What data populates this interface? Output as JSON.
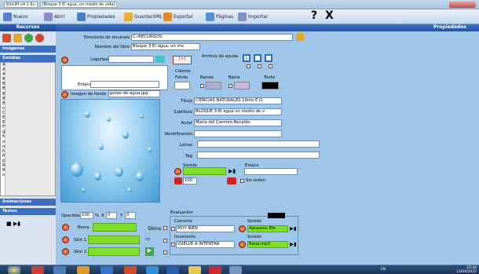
{
  "window": {
    "app_title": "EdiLIM v4.1.6v",
    "document_title": "[Bloque 3 El agua, un medio de vida]"
  },
  "menu": {
    "nuevo": "Nuevo",
    "abrir": "Abrir",
    "propiedades": "Propiedades",
    "guardar": "GuardarXML",
    "exportar": "Exportar",
    "paginas": "Páginas",
    "importar": "Importar",
    "help": "?",
    "close": "X"
  },
  "left": {
    "recursos": "Recursos",
    "imagenes": "Imágenes",
    "sonidos": "Sonidos",
    "sound_files": [
      "ALVARO LA TOC.",
      "Aplausos Efecto",
      "Aplausos Efecto",
      "Bach.mp3",
      "BALADA PARA AD",
      "BALADA PARA AD",
      "BALADA PARA AD",
      "Beethoven.mp3",
      "BG Foleys sonido",
      "caballo.mp3",
      "Cruz Roja Ubeda",
      "EL SONIDO DE LC",
      "Elefante.mp3",
      "Fresa.mp3",
      "gallo.mp3",
      "Manzana.mp3",
      "mozart.mp3",
      "muy bien sigue as",
      "Naranja.mp3",
      "Para Elisa tutoria",
      "prokofiev.mp3",
      "Rana.mp3",
      "Richard Claydem",
      "saint-saens.mp3"
    ],
    "animaciones": "Animaciones",
    "textos": "Textos",
    "play": "■ ▶▮"
  },
  "main": {
    "header": "Propiedades",
    "dir_label": "Directorio de recursos",
    "dir_value": "C:\\RECURSOS\\",
    "book_label": "Nombre del libro",
    "book_value": "Bloque 3 El agua, un me",
    "logotipo": "Logotipo",
    "logo_btn": "[+]",
    "help_file": "Archivo de ayuda",
    "help_i": "i",
    "enlace": "Enlace",
    "imagen_fondo": "Imagen de fondo",
    "fondo_value": "gotas-de-agua.jpg",
    "colores": "Colores",
    "fondo": "Fondo",
    "banda": "Banda",
    "barra": "Barra",
    "texto": "Texto",
    "titulo_label": "Título",
    "titulo_value": "CIENCIAS NATURALES 10mo E.G.",
    "subtitulo_label": "Subtitulo",
    "subtitulo_value": "BLOQUE 3 El agua un medio de v",
    "autor_label": "Autor",
    "autor_value": "María del Carmen Recalde",
    "identificacion_label": "Identificación",
    "letras_label": "Letras",
    "tag_label": "Tag",
    "sonido_label": "Sonido",
    "enlace2_label": "Enlace",
    "volume": "100",
    "sin_orden": "Sin orden",
    "opacidad_label": "Opacidad",
    "opacidad_value": "100",
    "pct": "%",
    "x_label": "X",
    "x_value": "0",
    "y_label": "Y",
    "y_value": "0",
    "barra_label": "Barra",
    "skins": "Skins",
    "skin1": "Skin 1",
    "skin2": "Skin 2",
    "evaluacion": "Evaluación",
    "correcto": "Correcto",
    "correcto_value": "MUY BIEN",
    "sonido_c": "Sonido",
    "sonido_c_value": "Aplausos Efe",
    "incorrecto": "Incorrecto",
    "incorrecto_value": "VUELVE A INTENTAR",
    "sonido_i": "Sonido",
    "sonido_i_value": "Rana.mp3"
  },
  "taskbar": {
    "time": "23:34",
    "date": "13/04/2022",
    "tray": "EN"
  },
  "colors": {
    "accent": "#2f64b8",
    "green": "#7fe02a",
    "panel": "#9fc6e8"
  }
}
